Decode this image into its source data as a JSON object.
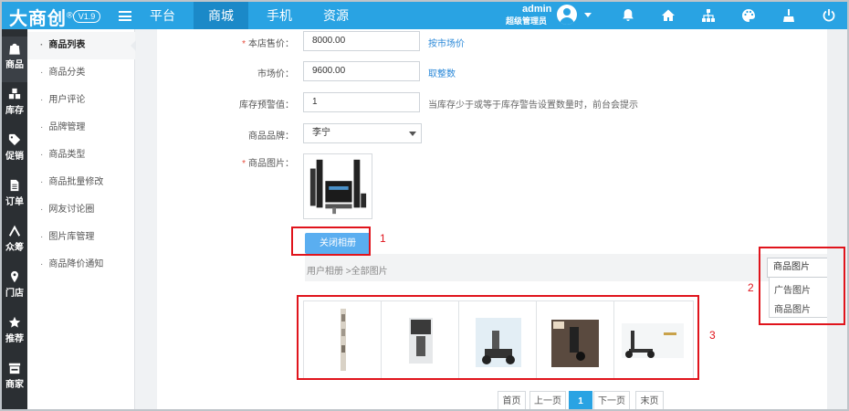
{
  "brand": {
    "logo": "大商创",
    "version": "V1.9"
  },
  "nav": {
    "tabs": [
      {
        "label": "平台"
      },
      {
        "label": "商城"
      },
      {
        "label": "手机"
      },
      {
        "label": "资源"
      }
    ],
    "active_tab": "商城"
  },
  "user": {
    "name": "admin",
    "role": "超级管理员"
  },
  "top_icons": [
    "bell-icon",
    "home-icon",
    "sitemap-icon",
    "palette-icon",
    "broom-icon",
    "power-icon"
  ],
  "leftbar": {
    "items": [
      {
        "label": "商品",
        "icon": "bag-icon"
      },
      {
        "label": "库存",
        "icon": "cubes-icon"
      },
      {
        "label": "促销",
        "icon": "tag-icon"
      },
      {
        "label": "订单",
        "icon": "document-icon"
      },
      {
        "label": "众筹",
        "icon": "fork-icon"
      },
      {
        "label": "门店",
        "icon": "pin-icon"
      },
      {
        "label": "推荐",
        "icon": "star-icon"
      },
      {
        "label": "商家",
        "icon": "store-icon"
      }
    ]
  },
  "submenu": {
    "items": [
      {
        "label": "商品列表"
      },
      {
        "label": "商品分类"
      },
      {
        "label": "用户评论"
      },
      {
        "label": "品牌管理"
      },
      {
        "label": "商品类型"
      },
      {
        "label": "商品批量修改"
      },
      {
        "label": "网友讨论圈"
      },
      {
        "label": "图片库管理"
      },
      {
        "label": "商品降价通知"
      }
    ]
  },
  "form": {
    "store_price": {
      "label": "本店售价：",
      "value": "8000.00",
      "link": "按市场价"
    },
    "market_price": {
      "label": "市场价：",
      "value": "9600.00",
      "link": "取整数"
    },
    "stock_warning": {
      "label": "库存预警值：",
      "value": "1",
      "hint": "当库存少于或等于库存警告设置数量时，前台会提示"
    },
    "brand": {
      "label": "商品品牌：",
      "value": "李宁"
    },
    "image": {
      "label": "商品图片："
    }
  },
  "album": {
    "close_button": "关闭相册",
    "breadcrumb": "用户相册 >全部图片",
    "dropdown": {
      "selected": "商品图片",
      "options": [
        "广告图片",
        "商品图片"
      ]
    }
  },
  "pagination": {
    "first": "首页",
    "prev": "上一页",
    "current": "1",
    "next": "下一页",
    "last": "末页"
  },
  "annotations": {
    "a1": "1",
    "a2": "2",
    "a3": "3"
  },
  "colors": {
    "topbar": "#29a3e3",
    "sidebar": "#2b2f33",
    "link": "#2a88d8",
    "annotation": "#e0141c"
  }
}
